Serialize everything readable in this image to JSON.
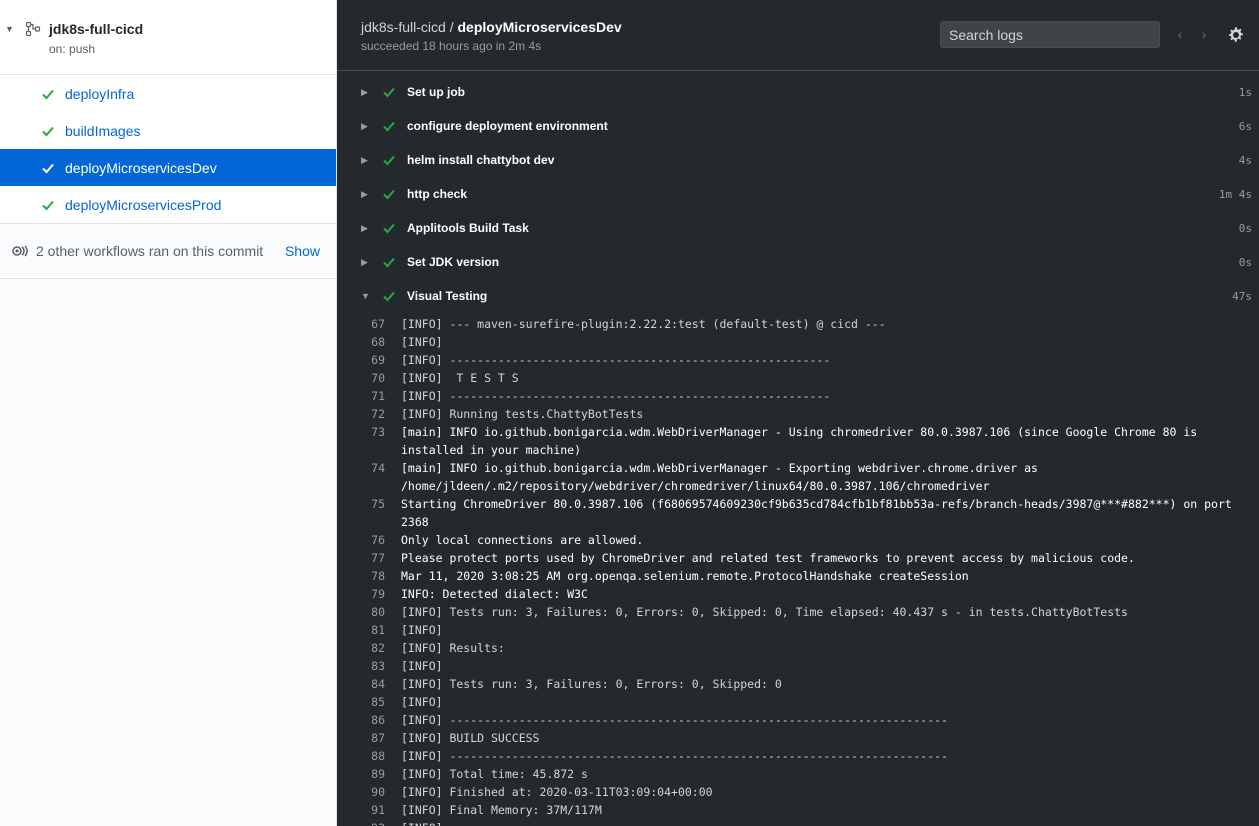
{
  "sidebar": {
    "workflow_title": "jdk8s-full-cicd",
    "workflow_trigger": "on: push",
    "jobs": [
      {
        "label": "deployInfra",
        "active": false
      },
      {
        "label": "buildImages",
        "active": false
      },
      {
        "label": "deployMicroservicesDev",
        "active": true
      },
      {
        "label": "deployMicroservicesProd",
        "active": false
      }
    ],
    "other_workflows_text": "2 other workflows ran on this commit",
    "show_label": "Show"
  },
  "main": {
    "workflow": "jdk8s-full-cicd",
    "separator": " / ",
    "job": "deployMicroservicesDev",
    "status": "succeeded 18 hours ago in 2m 4s",
    "search_placeholder": "Search logs",
    "steps": [
      {
        "name": "Set up job",
        "duration": "1s"
      },
      {
        "name": "configure deployment environment",
        "duration": "6s"
      },
      {
        "name": "helm install chattybot dev",
        "duration": "4s"
      },
      {
        "name": "http check",
        "duration": "1m 4s"
      },
      {
        "name": "Applitools Build Task",
        "duration": "0s"
      },
      {
        "name": "Set JDK version",
        "duration": "0s"
      },
      {
        "name": "Visual Testing",
        "duration": "47s"
      }
    ],
    "log_lines": [
      {
        "n": "67",
        "t": "[INFO] --- maven-surefire-plugin:2.22.2:test (default-test) @ cicd ---",
        "plain": false
      },
      {
        "n": "68",
        "t": "[INFO]",
        "plain": false
      },
      {
        "n": "69",
        "t": "[INFO] -------------------------------------------------------",
        "plain": false
      },
      {
        "n": "70",
        "t": "[INFO]  T E S T S",
        "plain": false
      },
      {
        "n": "71",
        "t": "[INFO] -------------------------------------------------------",
        "plain": false
      },
      {
        "n": "72",
        "t": "[INFO] Running tests.ChattyBotTests",
        "plain": false
      },
      {
        "n": "73",
        "t": "[main] INFO io.github.bonigarcia.wdm.WebDriverManager - Using chromedriver 80.0.3987.106 (since Google Chrome 80 is installed in your machine)",
        "plain": true
      },
      {
        "n": "74",
        "t": "[main] INFO io.github.bonigarcia.wdm.WebDriverManager - Exporting webdriver.chrome.driver as /home/jldeen/.m2/repository/webdriver/chromedriver/linux64/80.0.3987.106/chromedriver",
        "plain": true
      },
      {
        "n": "75",
        "t": "Starting ChromeDriver 80.0.3987.106 (f68069574609230cf9b635cd784cfb1bf81bb53a-refs/branch-heads/3987@***#882***) on port 2368",
        "plain": true
      },
      {
        "n": "76",
        "t": "Only local connections are allowed.",
        "plain": true
      },
      {
        "n": "77",
        "t": "Please protect ports used by ChromeDriver and related test frameworks to prevent access by malicious code.",
        "plain": true
      },
      {
        "n": "78",
        "t": "Mar 11, 2020 3:08:25 AM org.openqa.selenium.remote.ProtocolHandshake createSession",
        "plain": true
      },
      {
        "n": "79",
        "t": "INFO: Detected dialect: W3C",
        "plain": true
      },
      {
        "n": "80",
        "t": "[INFO] Tests run: 3, Failures: 0, Errors: 0, Skipped: 0, Time elapsed: 40.437 s - in tests.ChattyBotTests",
        "plain": false
      },
      {
        "n": "81",
        "t": "[INFO]",
        "plain": false
      },
      {
        "n": "82",
        "t": "[INFO] Results:",
        "plain": false
      },
      {
        "n": "83",
        "t": "[INFO]",
        "plain": false
      },
      {
        "n": "84",
        "t": "[INFO] Tests run: 3, Failures: 0, Errors: 0, Skipped: 0",
        "plain": false
      },
      {
        "n": "85",
        "t": "[INFO]",
        "plain": false
      },
      {
        "n": "86",
        "t": "[INFO] ------------------------------------------------------------------------",
        "plain": false
      },
      {
        "n": "87",
        "t": "[INFO] BUILD SUCCESS",
        "plain": false
      },
      {
        "n": "88",
        "t": "[INFO] ------------------------------------------------------------------------",
        "plain": false
      },
      {
        "n": "89",
        "t": "[INFO] Total time: 45.872 s",
        "plain": false
      },
      {
        "n": "90",
        "t": "[INFO] Finished at: 2020-03-11T03:09:04+00:00",
        "plain": false
      },
      {
        "n": "91",
        "t": "[INFO] Final Memory: 37M/117M",
        "plain": false
      },
      {
        "n": "92",
        "t": "[INFO] ------------------------------------------------------------------------",
        "plain": false
      }
    ]
  },
  "colors": {
    "success": "#28a745",
    "link": "#0366d6",
    "log_bg": "#24292e"
  }
}
